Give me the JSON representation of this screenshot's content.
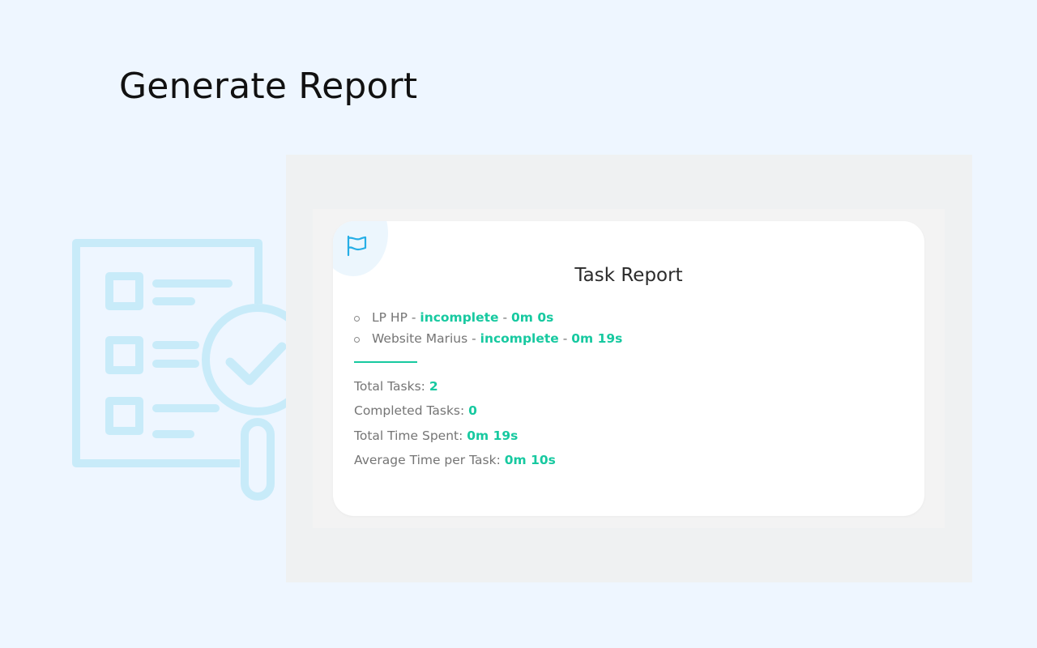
{
  "page": {
    "title": "Generate Report"
  },
  "colors": {
    "background": "#eef6ff",
    "accent": "#17c9a0",
    "illustration": "#c8ebf9",
    "icon_blue": "#25aee6"
  },
  "illustration": {
    "icon": "report-checklist-magnifier-icon"
  },
  "report": {
    "icon": "flag-icon",
    "title": "Task Report",
    "tasks": [
      {
        "name": "LP HP",
        "status": "incomplete",
        "time": "0m 0s"
      },
      {
        "name": "Website Marius",
        "status": "incomplete",
        "time": "0m 19s"
      }
    ],
    "stats": {
      "total_tasks": {
        "label": "Total Tasks:",
        "value": "2"
      },
      "completed_tasks": {
        "label": "Completed Tasks:",
        "value": "0"
      },
      "total_time": {
        "label": "Total Time Spent:",
        "value": "0m 19s"
      },
      "average_time": {
        "label": "Average Time per Task:",
        "value": "0m 10s"
      }
    }
  }
}
